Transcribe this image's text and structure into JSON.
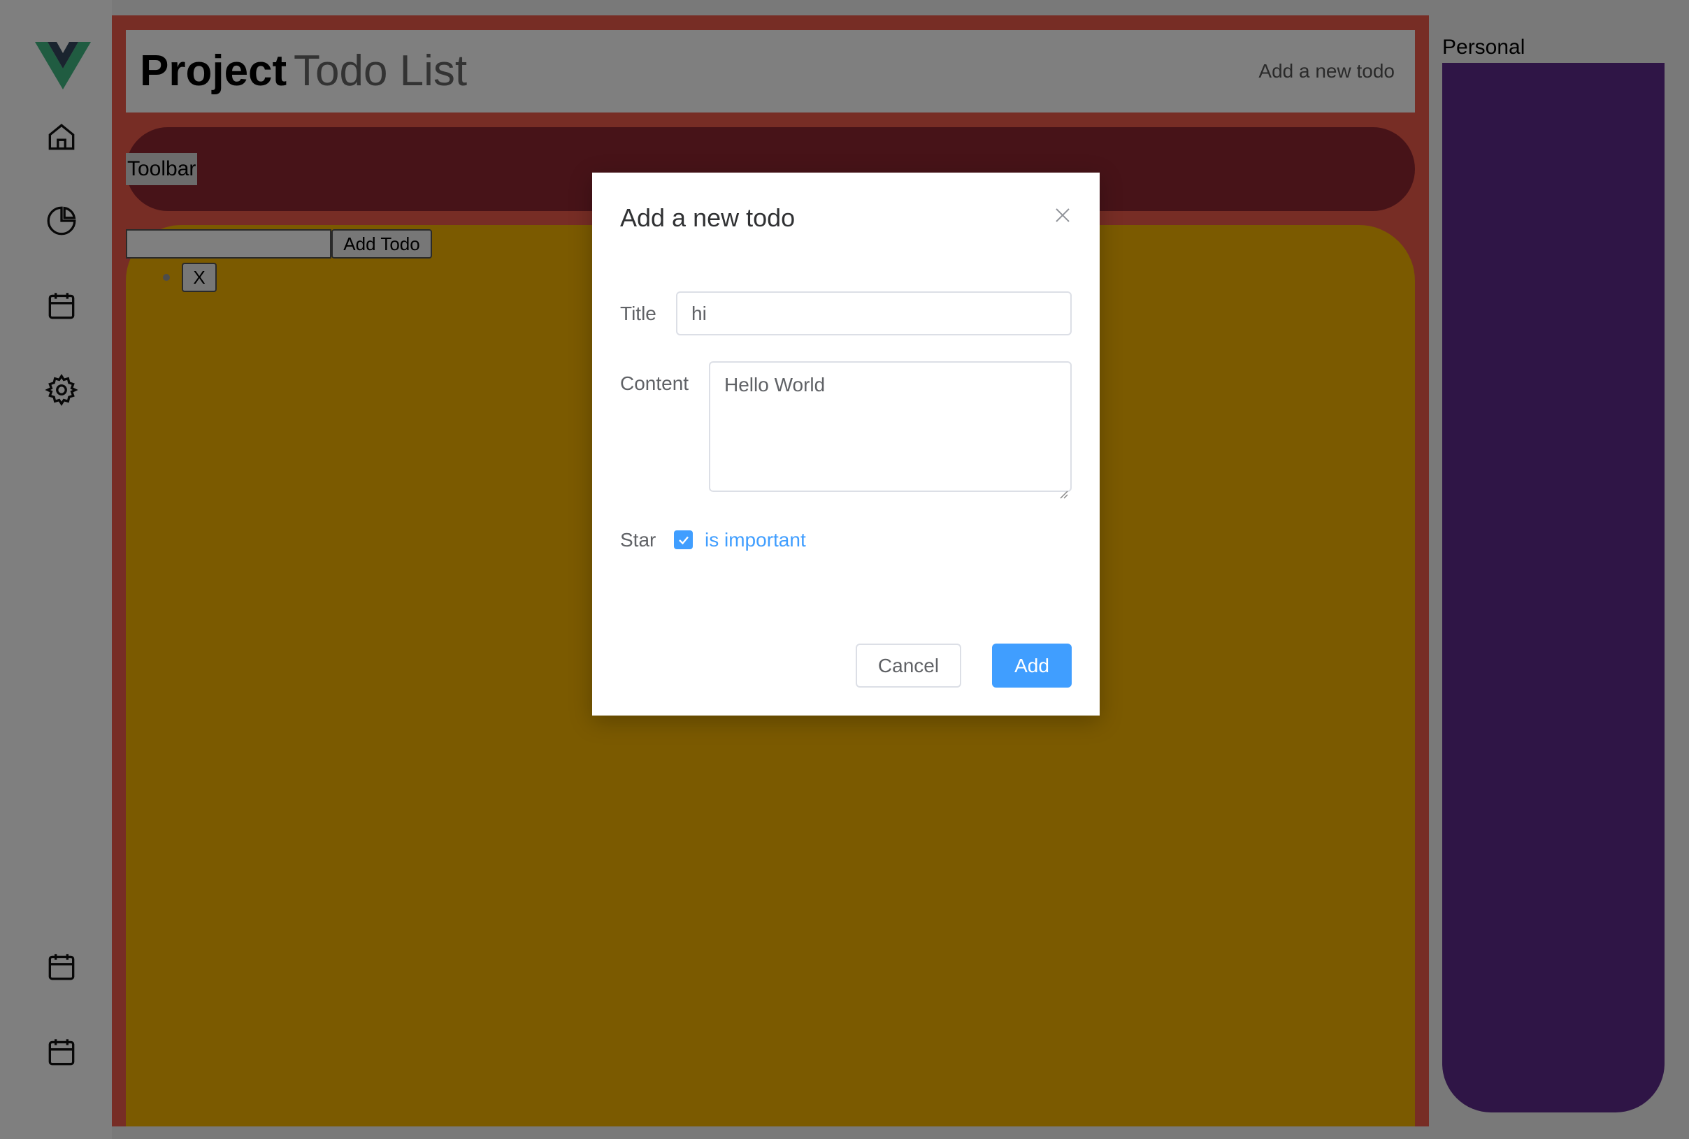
{
  "sidebar": {
    "logo": "vue-logo",
    "top_icons": [
      "home-icon",
      "pie-chart-icon",
      "calendar-icon",
      "gear-icon"
    ],
    "bottom_icons": [
      "calendar-icon",
      "calendar-icon"
    ]
  },
  "header": {
    "title_strong": "Project",
    "title_light": "Todo List",
    "add_link": "Add a new todo"
  },
  "toolbar": {
    "label": "Toolbar"
  },
  "todo": {
    "input_value": "",
    "add_button": "Add Todo",
    "items": [
      {
        "text": "",
        "remove_label": "X"
      }
    ]
  },
  "right_panel": {
    "title": "Personal"
  },
  "dialog": {
    "title": "Add a new todo",
    "fields": {
      "title_label": "Title",
      "title_value": "hi",
      "content_label": "Content",
      "content_value": "Hello World",
      "star_label": "Star",
      "star_text": "is important",
      "star_checked": true
    },
    "buttons": {
      "cancel": "Cancel",
      "add": "Add"
    }
  },
  "colors": {
    "accent": "#409eff",
    "main_bg": "#ee5b4a",
    "toolbar_bg": "#8f2630",
    "content_bg": "#f7b500",
    "right_panel_bg": "#5e2a8c",
    "overlay": "rgba(0,0,0,0.5)"
  }
}
